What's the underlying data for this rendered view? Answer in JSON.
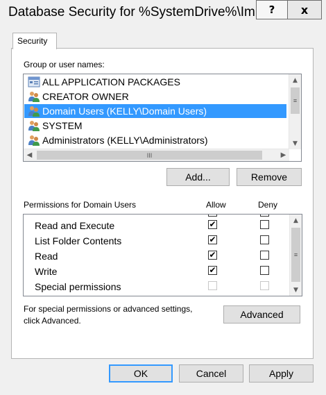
{
  "window": {
    "title": "Database Security for %SystemDrive%\\Im...",
    "help_glyph": "?",
    "close_glyph": "x"
  },
  "tabs": [
    {
      "label": "Security"
    }
  ],
  "users": {
    "label": "Group or user names:",
    "items": [
      {
        "name": "ALL APPLICATION PACKAGES",
        "icon": "package-icon",
        "selected": false
      },
      {
        "name": "CREATOR OWNER",
        "icon": "users-icon",
        "selected": false
      },
      {
        "name": "Domain Users (KELLY\\Domain Users)",
        "icon": "users-icon",
        "selected": true
      },
      {
        "name": "SYSTEM",
        "icon": "users-icon",
        "selected": false
      },
      {
        "name": "Administrators (KELLY\\Administrators)",
        "icon": "users-icon",
        "selected": false
      }
    ],
    "hscroll_thumb_grip": "III"
  },
  "buttons": {
    "add": "Add...",
    "remove": "Remove",
    "advanced": "Advanced",
    "ok": "OK",
    "cancel": "Cancel",
    "apply": "Apply"
  },
  "permissions": {
    "title": "Permissions for Domain Users",
    "allow_header": "Allow",
    "deny_header": "Deny",
    "rows": [
      {
        "name": "Read and Execute",
        "allow": true,
        "deny": false,
        "disabled": false
      },
      {
        "name": "List Folder Contents",
        "allow": true,
        "deny": false,
        "disabled": false
      },
      {
        "name": "Read",
        "allow": true,
        "deny": false,
        "disabled": false
      },
      {
        "name": "Write",
        "allow": true,
        "deny": false,
        "disabled": false
      },
      {
        "name": "Special permissions",
        "allow": false,
        "deny": false,
        "disabled": true
      }
    ]
  },
  "advanced_text": {
    "line1": "For special permissions or advanced settings,",
    "line2": "click Advanced."
  },
  "colors": {
    "selection": "#3399ff",
    "check": "#000000"
  }
}
